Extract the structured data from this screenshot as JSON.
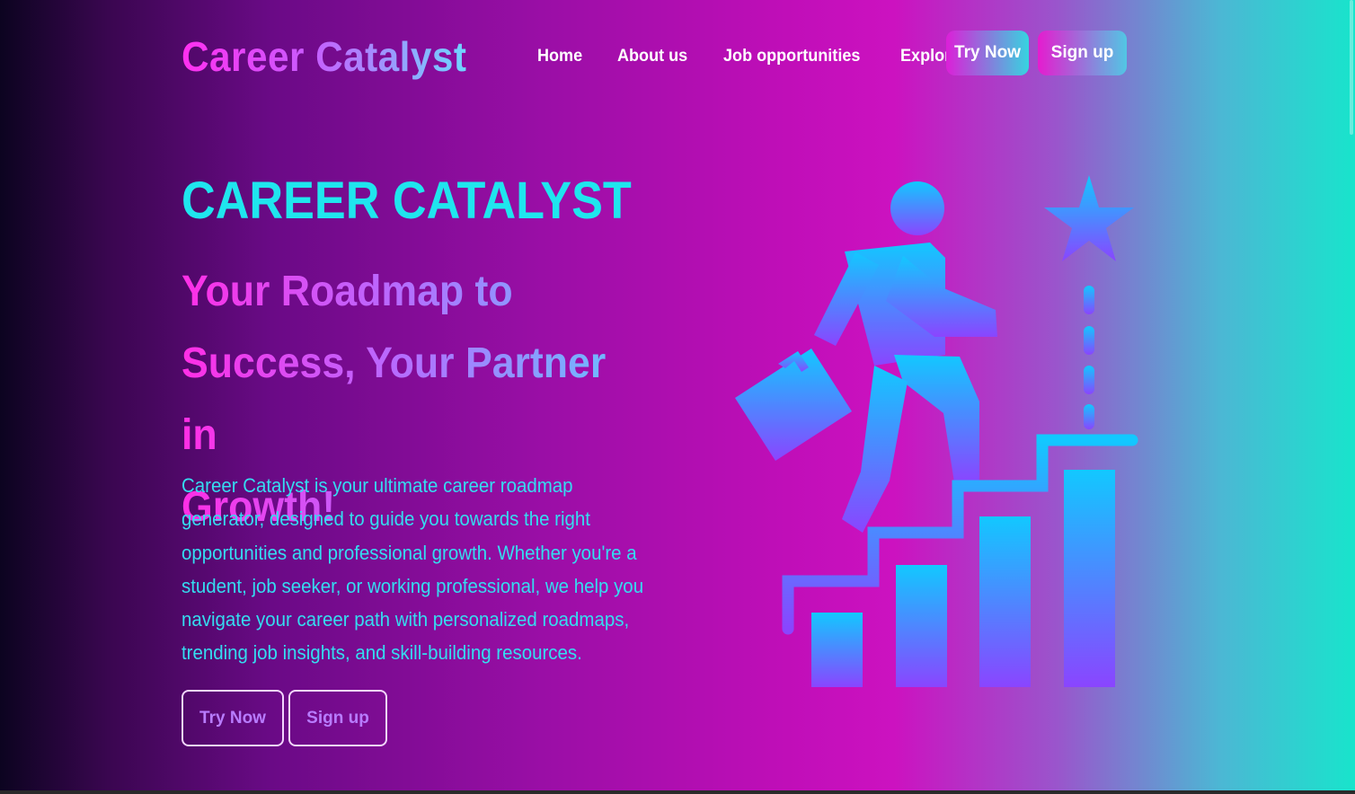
{
  "nav": {
    "logo": "Career Catalyst",
    "links": [
      "Home",
      "About us",
      "Job opportunities",
      "Explore"
    ],
    "explore_caret": "▼",
    "try_now": "Try Now",
    "sign_up": "Sign up"
  },
  "hero": {
    "title": "CAREER CATALYST",
    "tagline_lines": [
      "Your Roadmap to",
      "Success, Your Partner in",
      "Growth!"
    ],
    "description": "Career Catalyst is your ultimate career roadmap generator, designed to guide you towards the right opportunities and professional growth. Whether you're a student, job seeker, or working professional, we help you navigate your career path with personalized roadmaps, trending job insights, and skill-building resources.",
    "try_now": "Try Now",
    "sign_up": "Sign up"
  },
  "illustration": {
    "icon": "career-growth-icon",
    "colors": {
      "top": "#12c8ff",
      "bottom": "#8a45ff"
    }
  },
  "colors": {
    "accent_cyan": "#1fe6ee",
    "accent_magenta": "#ff2ee6",
    "description_text": "#35dcf0"
  }
}
